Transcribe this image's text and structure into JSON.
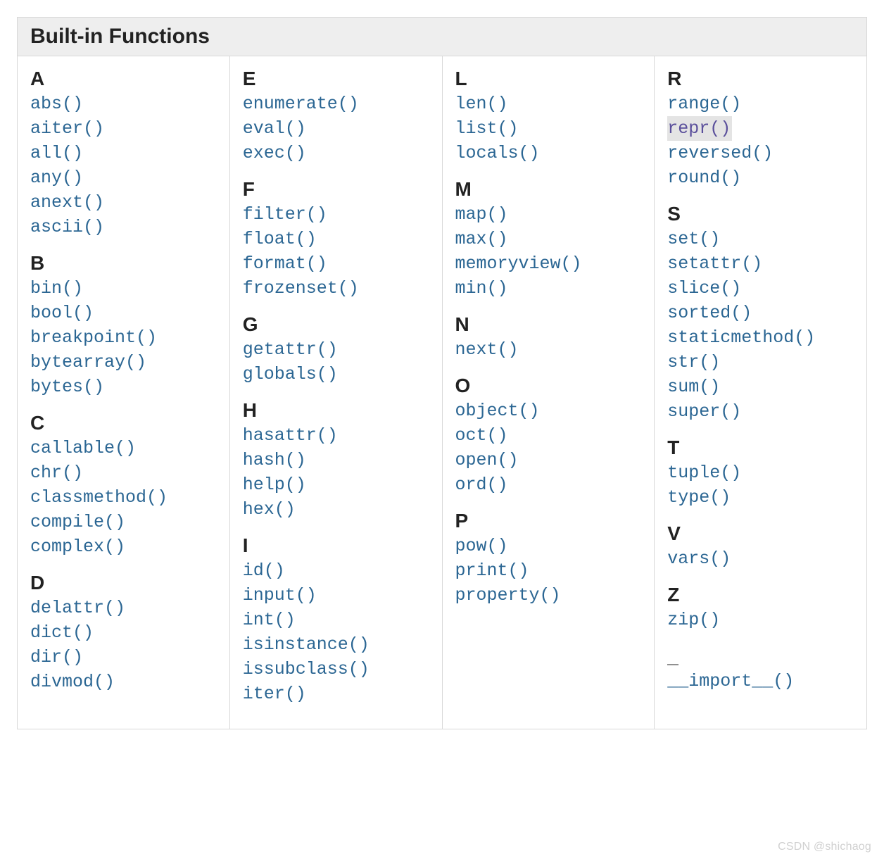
{
  "title": "Built-in Functions",
  "columns": [
    {
      "sections": [
        {
          "heading": "A",
          "items": [
            {
              "label": "abs()"
            },
            {
              "label": "aiter()"
            },
            {
              "label": "all()"
            },
            {
              "label": "any()"
            },
            {
              "label": "anext()"
            },
            {
              "label": "ascii()"
            }
          ]
        },
        {
          "heading": "B",
          "items": [
            {
              "label": "bin()"
            },
            {
              "label": "bool()"
            },
            {
              "label": "breakpoint()"
            },
            {
              "label": "bytearray()"
            },
            {
              "label": "bytes()"
            }
          ]
        },
        {
          "heading": "C",
          "items": [
            {
              "label": "callable()"
            },
            {
              "label": "chr()"
            },
            {
              "label": "classmethod()"
            },
            {
              "label": "compile()"
            },
            {
              "label": "complex()"
            }
          ]
        },
        {
          "heading": "D",
          "items": [
            {
              "label": "delattr()"
            },
            {
              "label": "dict()"
            },
            {
              "label": "dir()"
            },
            {
              "label": "divmod()"
            }
          ]
        }
      ]
    },
    {
      "sections": [
        {
          "heading": "E",
          "items": [
            {
              "label": "enumerate()"
            },
            {
              "label": "eval()"
            },
            {
              "label": "exec()"
            }
          ]
        },
        {
          "heading": "F",
          "items": [
            {
              "label": "filter()"
            },
            {
              "label": "float()"
            },
            {
              "label": "format()"
            },
            {
              "label": "frozenset()"
            }
          ]
        },
        {
          "heading": "G",
          "items": [
            {
              "label": "getattr()"
            },
            {
              "label": "globals()"
            }
          ]
        },
        {
          "heading": "H",
          "items": [
            {
              "label": "hasattr()"
            },
            {
              "label": "hash()"
            },
            {
              "label": "help()"
            },
            {
              "label": "hex()"
            }
          ]
        },
        {
          "heading": "I",
          "items": [
            {
              "label": "id()"
            },
            {
              "label": "input()"
            },
            {
              "label": "int()"
            },
            {
              "label": "isinstance()"
            },
            {
              "label": "issubclass()"
            },
            {
              "label": "iter()"
            }
          ]
        }
      ]
    },
    {
      "sections": [
        {
          "heading": "L",
          "items": [
            {
              "label": "len()"
            },
            {
              "label": "list()"
            },
            {
              "label": "locals()"
            }
          ]
        },
        {
          "heading": "M",
          "items": [
            {
              "label": "map()"
            },
            {
              "label": "max()"
            },
            {
              "label": "memoryview()"
            },
            {
              "label": "min()"
            }
          ]
        },
        {
          "heading": "N",
          "items": [
            {
              "label": "next()"
            }
          ]
        },
        {
          "heading": "O",
          "items": [
            {
              "label": "object()"
            },
            {
              "label": "oct()"
            },
            {
              "label": "open()"
            },
            {
              "label": "ord()"
            }
          ]
        },
        {
          "heading": "P",
          "items": [
            {
              "label": "pow()"
            },
            {
              "label": "print()"
            },
            {
              "label": "property()"
            }
          ]
        }
      ]
    },
    {
      "sections": [
        {
          "heading": "R",
          "items": [
            {
              "label": "range()"
            },
            {
              "label": "repr()",
              "highlighted": true
            },
            {
              "label": "reversed()"
            },
            {
              "label": "round()"
            }
          ]
        },
        {
          "heading": "S",
          "items": [
            {
              "label": "set()"
            },
            {
              "label": "setattr()"
            },
            {
              "label": "slice()"
            },
            {
              "label": "sorted()"
            },
            {
              "label": "staticmethod()"
            },
            {
              "label": "str()"
            },
            {
              "label": "sum()"
            },
            {
              "label": "super()"
            }
          ]
        },
        {
          "heading": "T",
          "items": [
            {
              "label": "tuple()"
            },
            {
              "label": "type()"
            }
          ]
        },
        {
          "heading": "V",
          "items": [
            {
              "label": "vars()"
            }
          ]
        },
        {
          "heading": "Z",
          "items": [
            {
              "label": "zip()"
            }
          ]
        },
        {
          "heading": "_",
          "items": [
            {
              "label": "__import__()"
            }
          ]
        }
      ]
    }
  ],
  "watermark": "CSDN @shichaog"
}
